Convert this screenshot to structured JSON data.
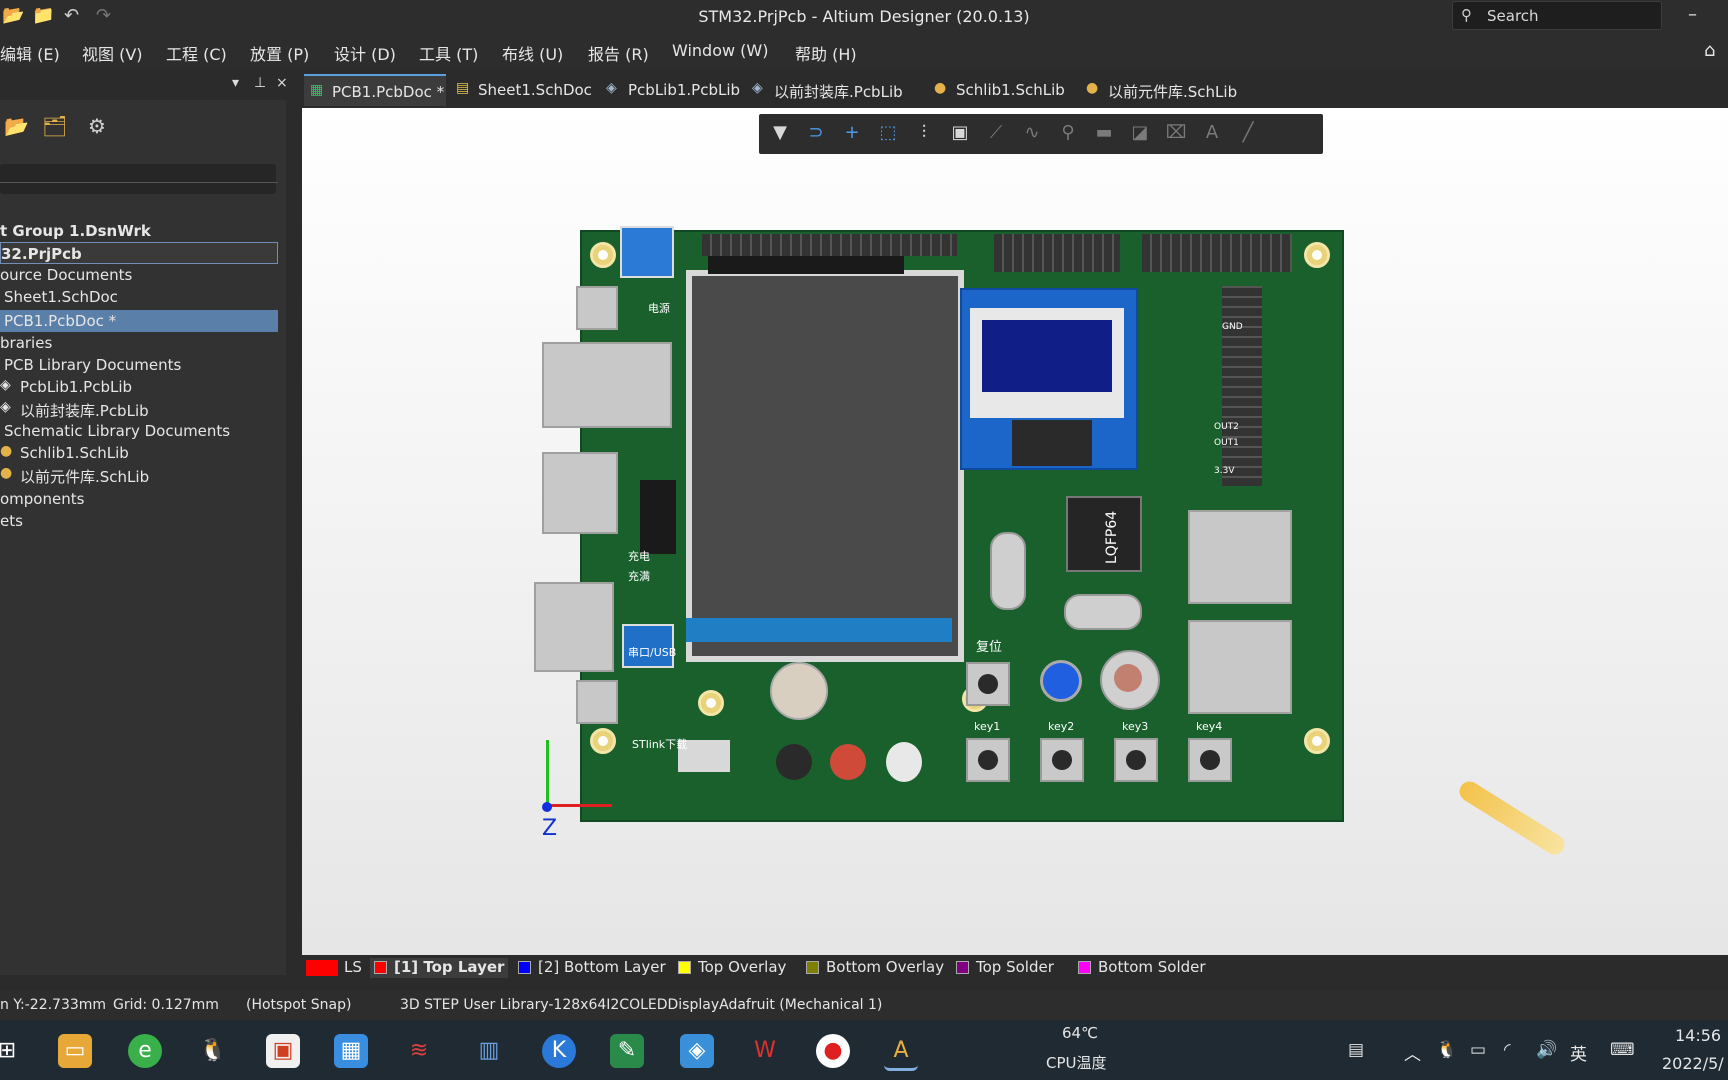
{
  "window": {
    "title": "STM32.PrjPcb - Altium Designer (20.0.13)",
    "search_placeholder": "Search"
  },
  "menu": [
    "编辑 (E)",
    "视图 (V)",
    "工程 (C)",
    "放置 (P)",
    "设计 (D)",
    "工具 (T)",
    "布线 (U)",
    "报告 (R)",
    "Window (W)",
    "帮助 (H)"
  ],
  "panel": {
    "controls": [
      "▾",
      "⊥",
      "×"
    ],
    "search_text": "",
    "tree": [
      {
        "label": "t Group 1.DsnWrk",
        "bold": true
      },
      {
        "label": "32.PrjPcb",
        "bold": true,
        "focus": true
      },
      {
        "label": "ource Documents"
      },
      {
        "label": "Sheet1.SchDoc"
      },
      {
        "label": "PCB1.PcbDoc *",
        "selected": true
      },
      {
        "label": "braries"
      },
      {
        "label": "PCB Library Documents"
      },
      {
        "label": "PcbLib1.PcbLib"
      },
      {
        "label": "以前封装库.PcbLib"
      },
      {
        "label": "Schematic Library Documents"
      },
      {
        "label": "Schlib1.SchLib"
      },
      {
        "label": "以前元件库.SchLib"
      },
      {
        "label": "omponents"
      },
      {
        "label": "ets"
      }
    ]
  },
  "tabs": [
    {
      "label": "PCB1.PcbDoc *",
      "active": true
    },
    {
      "label": "Sheet1.SchDoc"
    },
    {
      "label": "PcbLib1.PcbLib"
    },
    {
      "label": "以前封装库.PcbLib"
    },
    {
      "label": "Schlib1.SchLib"
    },
    {
      "label": "以前元件库.SchLib"
    }
  ],
  "board_labels": {
    "power": "电源",
    "charge": "充电",
    "full": "充满",
    "serial": "串口/USB",
    "reset": "复位",
    "keys": [
      "key1",
      "key2",
      "key3",
      "key4"
    ],
    "chip": "LQFP64",
    "stlink": "STlink下载",
    "axis_z": "Z",
    "gnd": "GND",
    "v33": "3.3V",
    "out2": "OUT2",
    "out1": "OUT1"
  },
  "layers": [
    {
      "label": "LS",
      "color": "#ff0000"
    },
    {
      "label": "[1] Top Layer",
      "color": "#ff0000",
      "active": true
    },
    {
      "label": "[2] Bottom Layer",
      "color": "#0000ff"
    },
    {
      "label": "Top Overlay",
      "color": "#ffff00"
    },
    {
      "label": "Bottom Overlay",
      "color": "#808000"
    },
    {
      "label": "Top Solder",
      "color": "#800080"
    },
    {
      "label": "Bottom Solder",
      "color": "#ff00ff"
    }
  ],
  "status": {
    "coords": "n Y:-22.733mm",
    "grid": "Grid: 0.127mm",
    "snap": "(Hotspot Snap)",
    "info": "3D STEP User Library-128x64I2COLEDDisplayAdafruit (Mechanical 1)"
  },
  "taskbar": {
    "temp": "64℃",
    "temp_label": "CPU温度",
    "ime": "英",
    "time": "14:56",
    "date": "2022/5/"
  }
}
